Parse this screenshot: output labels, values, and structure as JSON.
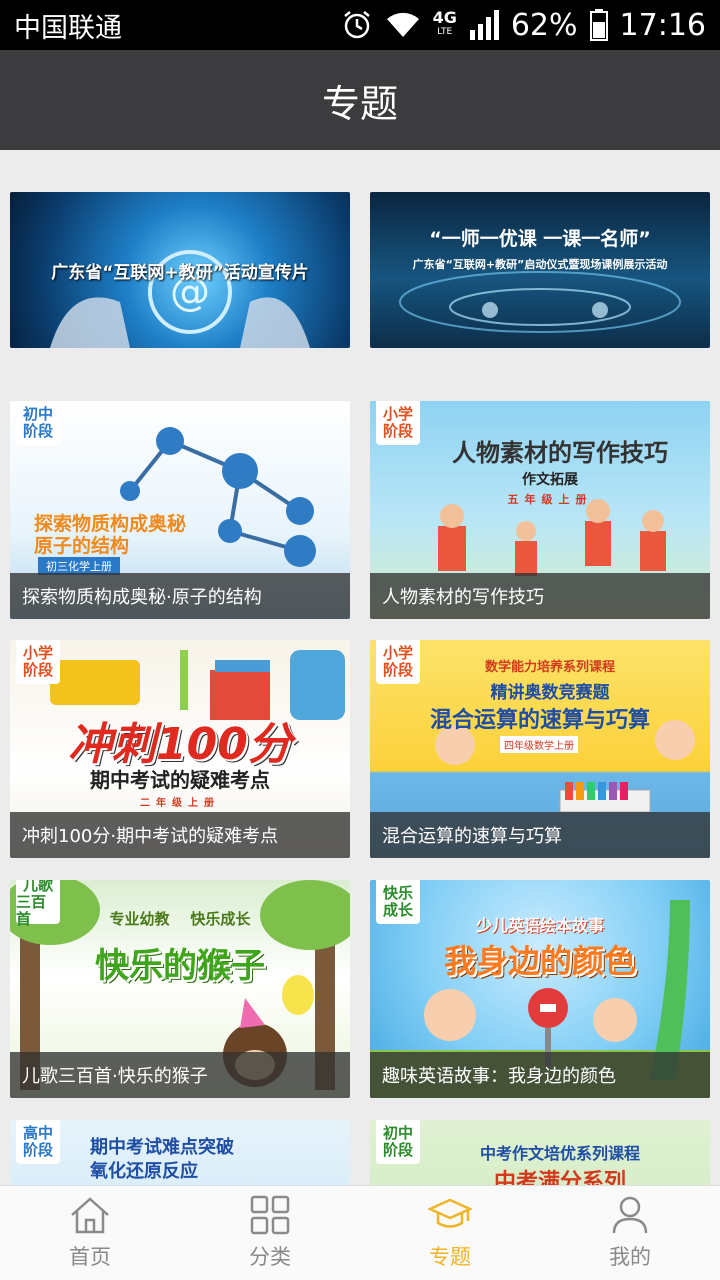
{
  "status_bar": {
    "carrier": "中国联通",
    "network": "4G",
    "network_sub": "LTE",
    "battery": "62%",
    "time": "17:16"
  },
  "header": {
    "title": "专题"
  },
  "topics": [
    {
      "banner_title": "广东省“互联网+教研”活动宣传片"
    },
    {
      "banner_title": "“一师一优课 一课一名师”",
      "banner_subtitle": "广东省“互联网+教研”启动仪式暨现场课例展示活动"
    },
    {
      "tag": [
        "初中",
        "阶段"
      ],
      "headline": [
        "探索物质构成奥秘",
        "原子的结构"
      ],
      "subline": "初三化学上册",
      "caption": "探索物质构成奥秘·原子的结构"
    },
    {
      "tag": [
        "小学",
        "阶段"
      ],
      "headline": [
        "人物素材的写作技巧"
      ],
      "subline": "作文拓展",
      "subline2": "五年级上册",
      "caption": "人物素材的写作技巧"
    },
    {
      "tag": [
        "小学",
        "阶段"
      ],
      "headline": [
        "冲刺100分"
      ],
      "subline": "期中考试的疑难考点",
      "subline2": "二年级上册",
      "caption": "冲刺100分·期中考试的疑难考点"
    },
    {
      "tag": [
        "小学",
        "阶段"
      ],
      "series": "数学能力培养系列课程",
      "headline": [
        "精讲奥数竞赛题",
        "混合运算的速算与巧算"
      ],
      "subline": "四年级数学上册",
      "caption": "混合运算的速算与巧算"
    },
    {
      "tag": [
        "儿歌",
        "三百首"
      ],
      "series": "专业幼教    快乐成长",
      "headline": [
        "快乐的猴子"
      ],
      "caption": "儿歌三百首·快乐的猴子"
    },
    {
      "tag": [
        "快乐",
        "成长"
      ],
      "series": "少儿英语绘本故事",
      "headline": [
        "我身边的颜色"
      ],
      "caption": "趣味英语故事：我身边的颜色"
    },
    {
      "tag": [
        "高中",
        "阶段"
      ],
      "headline": [
        "期中考试难点突破",
        "氧化还原反应"
      ]
    },
    {
      "tag": [
        "初中",
        "阶段"
      ],
      "headline": [
        "中考作文培优系列课程",
        "中考满分系列"
      ]
    }
  ],
  "bottom_nav": {
    "items": [
      {
        "label": "首页",
        "icon": "home-icon"
      },
      {
        "label": "分类",
        "icon": "grid-icon"
      },
      {
        "label": "专题",
        "icon": "graduation-cap-icon",
        "active": true
      },
      {
        "label": "我的",
        "icon": "user-icon"
      }
    ]
  },
  "colors": {
    "accent": "#f0b429",
    "titlebar": "#3c3c3e",
    "nav_inactive": "#8a8a8a"
  }
}
